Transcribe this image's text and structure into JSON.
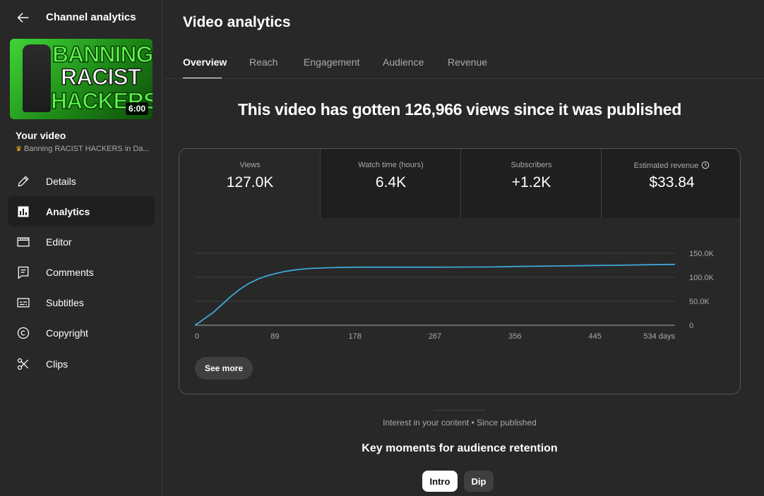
{
  "sidebar": {
    "title": "Channel analytics",
    "thumbnail": {
      "lines": [
        "BANNING",
        "RACIST",
        "HACKERS"
      ],
      "duration": "6:00"
    },
    "your_video_label": "Your video",
    "video_name": "Banning RACIST HACKERS in Da...",
    "items": [
      {
        "label": "Details",
        "icon": "pencil-icon"
      },
      {
        "label": "Analytics",
        "icon": "analytics-icon",
        "active": true
      },
      {
        "label": "Editor",
        "icon": "editor-icon"
      },
      {
        "label": "Comments",
        "icon": "comments-icon"
      },
      {
        "label": "Subtitles",
        "icon": "subtitles-icon"
      },
      {
        "label": "Copyright",
        "icon": "copyright-icon"
      },
      {
        "label": "Clips",
        "icon": "scissors-icon"
      }
    ]
  },
  "main": {
    "title": "Video analytics",
    "tabs": [
      {
        "label": "Overview",
        "active": true
      },
      {
        "label": "Reach"
      },
      {
        "label": "Engagement"
      },
      {
        "label": "Audience"
      },
      {
        "label": "Revenue"
      }
    ],
    "headline": "This video has gotten 126,966 views since it was published",
    "metrics": [
      {
        "label": "Views",
        "value": "127.0K"
      },
      {
        "label": "Watch time (hours)",
        "value": "6.4K"
      },
      {
        "label": "Subscribers",
        "value": "+1.2K"
      },
      {
        "label": "Estimated revenue",
        "value": "$33.84"
      }
    ],
    "see_more": "See more",
    "interest_text": "Interest in your content • Since published",
    "key_moments_title": "Key moments for audience retention",
    "chips": [
      "Intro",
      "Dip"
    ]
  },
  "colors": {
    "background": "#282828",
    "line": "#3ea6d8",
    "active_chip": "#ffffff"
  },
  "chart_data": {
    "type": "line",
    "x_tick_labels": [
      "0",
      "89",
      "178",
      "267",
      "356",
      "445",
      "534 days"
    ],
    "y_tick_labels": [
      "0",
      "50.0K",
      "100.0K",
      "150.0K"
    ],
    "xlim": [
      0,
      534
    ],
    "ylim": [
      0,
      150000
    ],
    "grid": true,
    "series": [
      {
        "x": [
          0,
          5,
          10,
          20,
          30,
          40,
          50,
          60,
          70,
          80,
          90,
          100,
          110,
          120,
          130,
          150,
          178,
          267,
          330,
          356,
          400,
          445,
          470,
          500,
          534
        ],
        "values": [
          0,
          6000,
          13000,
          26000,
          43000,
          60000,
          75000,
          87000,
          96000,
          103000,
          108000,
          112000,
          115000,
          117000,
          118500,
          120000,
          121000,
          121000,
          121500,
          122500,
          123500,
          124500,
          125000,
          126000,
          126966
        ]
      }
    ]
  }
}
